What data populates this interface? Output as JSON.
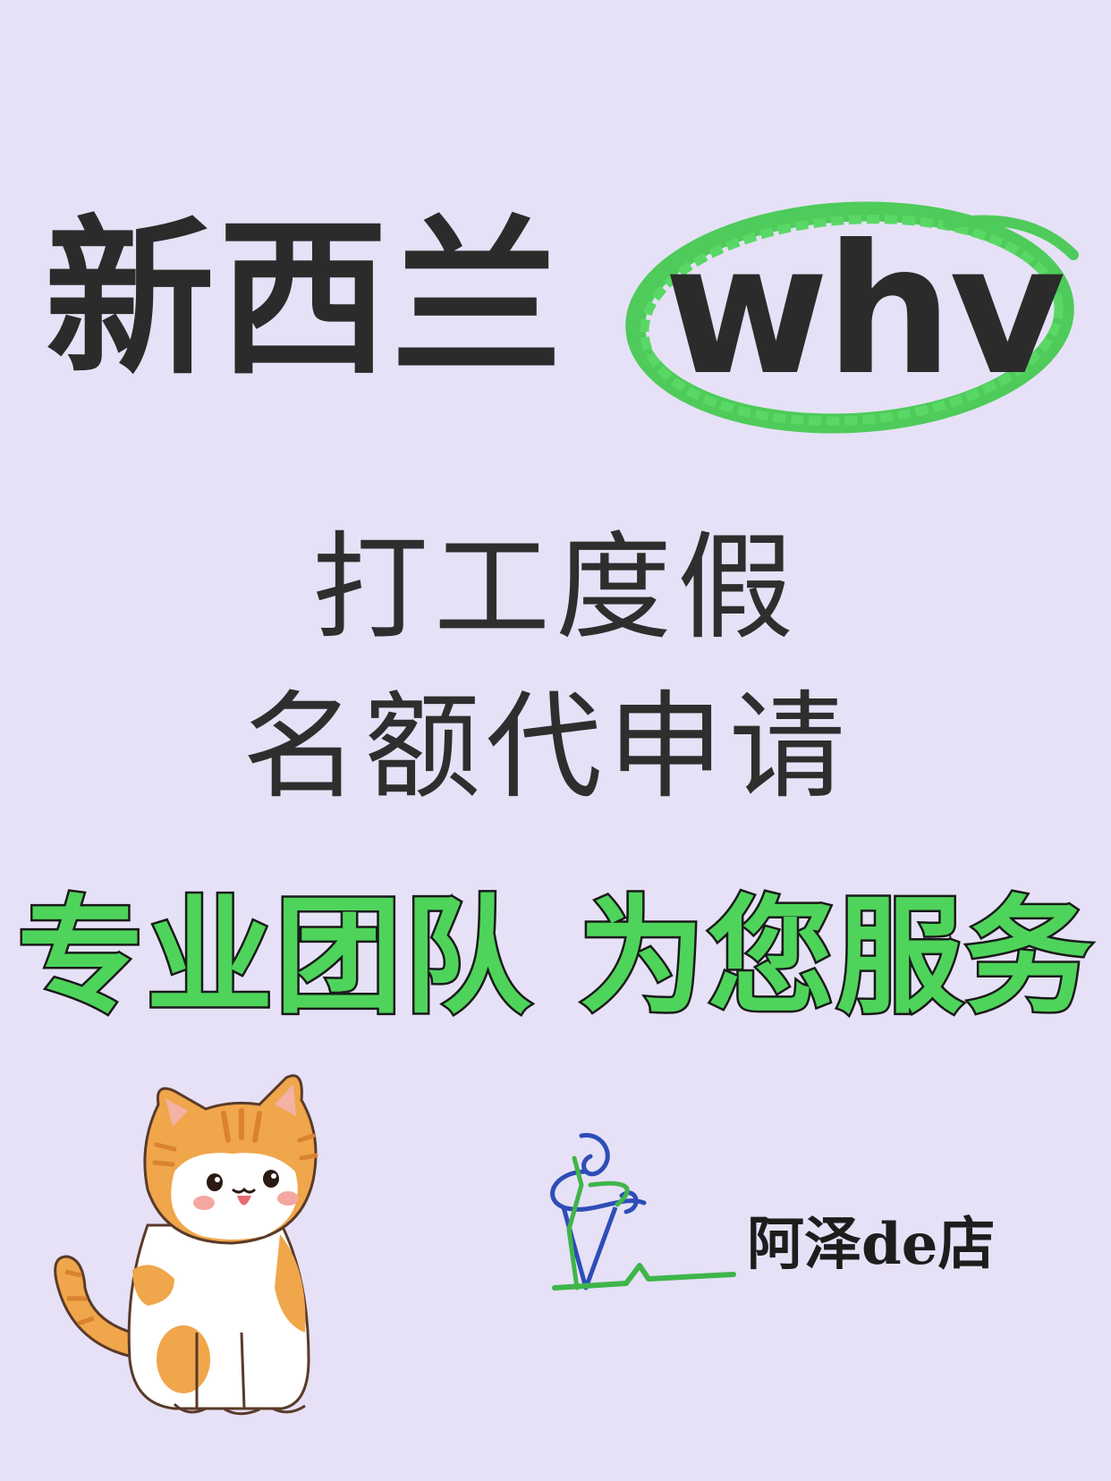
{
  "title": {
    "country": "新西兰",
    "visa": "whv"
  },
  "subtitle": {
    "line1": "打工度假",
    "line2": "名额代申请"
  },
  "slogan": "专业团队 为您服务",
  "shop": {
    "name": "阿泽de店"
  },
  "colors": {
    "background": "#e6e1f6",
    "accent_green": "#4ed45b",
    "text_dark": "#2b2b2b"
  },
  "icons": [
    "cat-illustration",
    "ice-cream-logo-icon"
  ]
}
